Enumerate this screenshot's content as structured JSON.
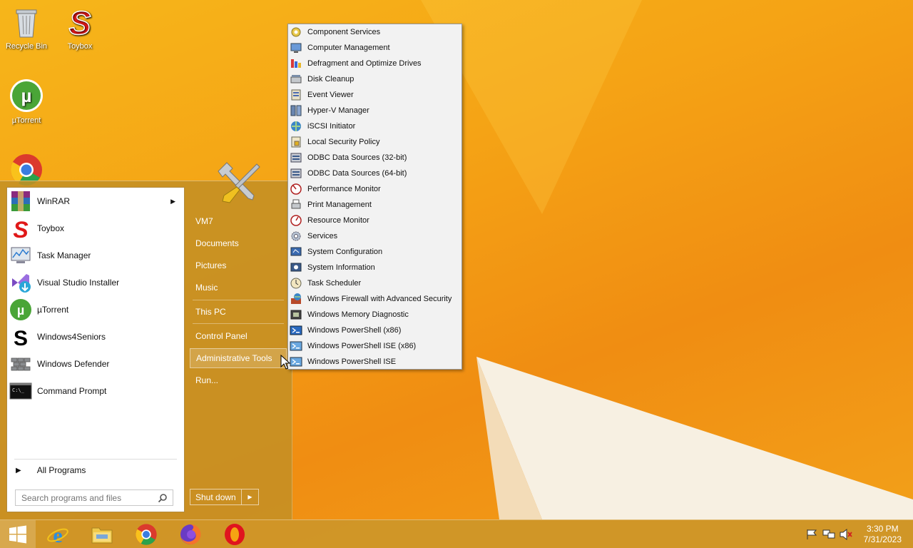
{
  "desktop": {
    "icons": [
      {
        "label": "Recycle Bin"
      },
      {
        "label": "Toybox"
      },
      {
        "label": "µTorrent"
      }
    ]
  },
  "start_menu": {
    "programs": [
      {
        "label": "WinRAR",
        "has_submenu": true
      },
      {
        "label": "Toybox"
      },
      {
        "label": "Task Manager"
      },
      {
        "label": "Visual Studio Installer"
      },
      {
        "label": "µTorrent"
      },
      {
        "label": "Windows4Seniors"
      },
      {
        "label": "Windows Defender"
      },
      {
        "label": "Command Prompt"
      }
    ],
    "all_programs_label": "All Programs",
    "search_placeholder": "Search programs and files",
    "right_links": [
      {
        "label": "VM7"
      },
      {
        "label": "Documents"
      },
      {
        "label": "Pictures"
      },
      {
        "label": "Music"
      },
      {
        "label": "This PC"
      },
      {
        "label": "Control Panel"
      },
      {
        "label": "Administrative Tools",
        "active": true
      },
      {
        "label": "Run..."
      }
    ],
    "shutdown_label": "Shut down"
  },
  "admin_tools": {
    "items": [
      {
        "label": "Component Services",
        "icon": "component-services-icon"
      },
      {
        "label": "Computer Management",
        "icon": "computer-management-icon"
      },
      {
        "label": "Defragment and Optimize Drives",
        "icon": "defragment-icon"
      },
      {
        "label": "Disk Cleanup",
        "icon": "disk-cleanup-icon"
      },
      {
        "label": "Event Viewer",
        "icon": "event-viewer-icon"
      },
      {
        "label": "Hyper-V Manager",
        "icon": "hyperv-icon"
      },
      {
        "label": "iSCSI Initiator",
        "icon": "iscsi-icon"
      },
      {
        "label": "Local Security Policy",
        "icon": "security-policy-icon"
      },
      {
        "label": "ODBC Data Sources (32-bit)",
        "icon": "odbc-icon"
      },
      {
        "label": "ODBC Data Sources (64-bit)",
        "icon": "odbc-icon"
      },
      {
        "label": "Performance Monitor",
        "icon": "performance-monitor-icon"
      },
      {
        "label": "Print Management",
        "icon": "print-management-icon"
      },
      {
        "label": "Resource Monitor",
        "icon": "resource-monitor-icon"
      },
      {
        "label": "Services",
        "icon": "services-gear-icon"
      },
      {
        "label": "System Configuration",
        "icon": "system-configuration-icon"
      },
      {
        "label": "System Information",
        "icon": "system-information-icon"
      },
      {
        "label": "Task Scheduler",
        "icon": "clock-icon"
      },
      {
        "label": "Windows Firewall with Advanced Security",
        "icon": "firewall-icon"
      },
      {
        "label": "Windows Memory Diagnostic",
        "icon": "memory-diagnostic-icon"
      },
      {
        "label": "Windows PowerShell (x86)",
        "icon": "powershell-icon"
      },
      {
        "label": "Windows PowerShell ISE (x86)",
        "icon": "powershell-ise-icon"
      },
      {
        "label": "Windows PowerShell ISE",
        "icon": "powershell-ise-icon"
      }
    ]
  },
  "taskbar": {
    "clock_time": "3:30 PM",
    "clock_date": "7/31/2023"
  },
  "colors": {
    "accent": "#c48f24",
    "submenu_bg": "#f2f2f2"
  }
}
